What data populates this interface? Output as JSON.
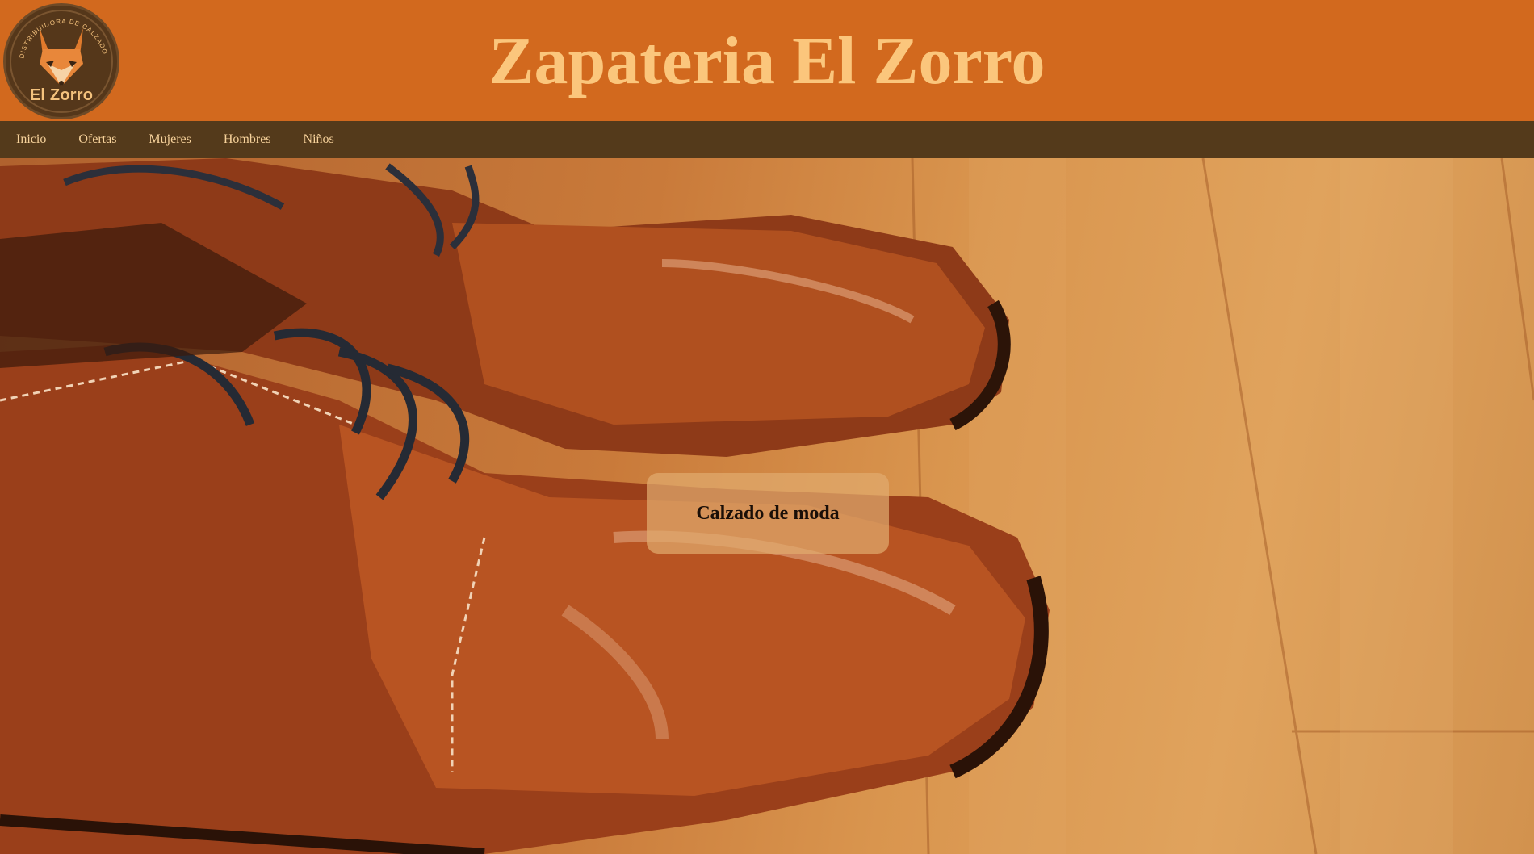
{
  "header": {
    "logo_text": "El Zorro",
    "logo_ring_text": "DISTRIBUIDORA DE CALZADO",
    "title": "Zapateria El Zorro"
  },
  "nav": {
    "items": [
      {
        "label": "Inicio"
      },
      {
        "label": "Ofertas"
      },
      {
        "label": "Mujeres"
      },
      {
        "label": "Hombres"
      },
      {
        "label": "Niños"
      }
    ]
  },
  "hero": {
    "caption": "Calzado de moda",
    "image_subject": "brown-leather-shoes-on-wood-floor"
  },
  "colors": {
    "header_bg": "#d2691e",
    "title_text": "#fbc67c",
    "nav_bg": "#543a1b",
    "nav_link": "#f7d29b",
    "logo_bg": "#55371a"
  }
}
